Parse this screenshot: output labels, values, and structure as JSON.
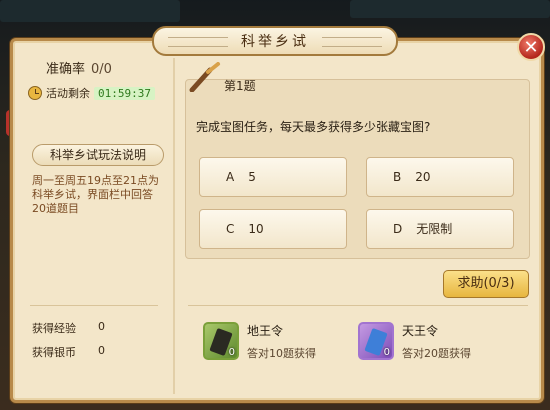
{
  "window": {
    "title": "科举乡试",
    "close_label": "✕"
  },
  "left": {
    "accuracy_label": "准确率",
    "accuracy_value": "0/0",
    "timer_label": "活动剩余",
    "timer_value": "01:59:37",
    "rules_button": "科举乡试玩法说明",
    "rules_text": "周一至周五19点至21点为科举乡试，界面栏中回答20道题目",
    "stats": [
      {
        "label": "获得经验",
        "value": "0"
      },
      {
        "label": "获得银币",
        "value": "0"
      }
    ]
  },
  "question": {
    "number": "第1题",
    "text": "完成宝图任务，每天最多获得多少张藏宝图?",
    "options": [
      {
        "letter": "A",
        "text": "5"
      },
      {
        "letter": "B",
        "text": "20"
      },
      {
        "letter": "C",
        "text": "10"
      },
      {
        "letter": "D",
        "text": "无限制"
      }
    ]
  },
  "help_button": "求助(0/3)",
  "rewards": [
    {
      "name": "地王令",
      "desc": "答对10题获得",
      "count": "0",
      "icon": "earth-token-icon"
    },
    {
      "name": "天王令",
      "desc": "答对20题获得",
      "count": "0",
      "icon": "heaven-token-icon"
    }
  ],
  "colors": {
    "panel_bg": "#f3e6c9",
    "border": "#b88a4a",
    "timer_green": "#2f7a1e",
    "help_gold": "#e7b63f",
    "close_red": "#b3261b"
  }
}
